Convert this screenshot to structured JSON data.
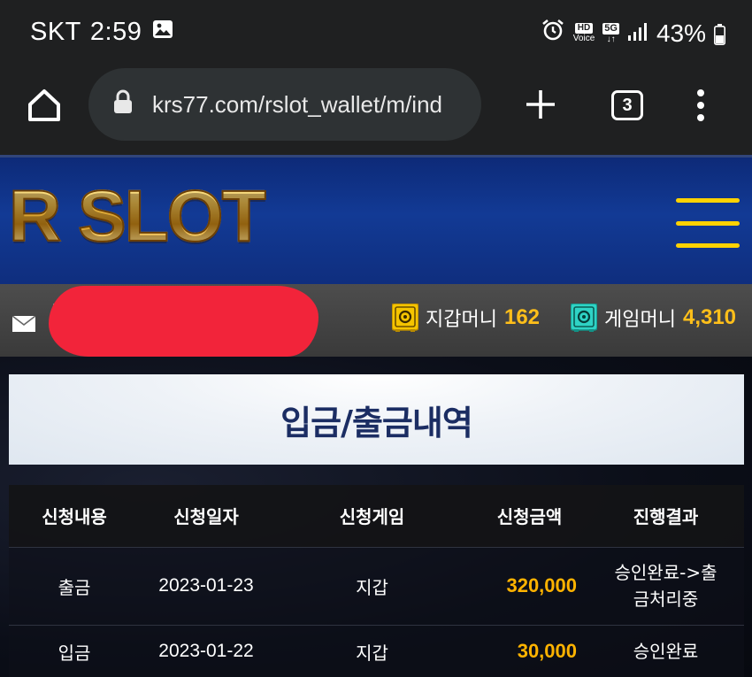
{
  "status_bar": {
    "carrier": "SKT",
    "time": "2:59",
    "hd_label": "HD",
    "voice_label": "Voice",
    "network_label": "5G",
    "battery": "43%"
  },
  "browser": {
    "url": "krs77.com/rslot_wallet/m/ind",
    "tab_count": "3"
  },
  "site": {
    "logo": "R SLOT"
  },
  "wallet": {
    "wallet_money_label": "지갑머니",
    "wallet_money_value": "162",
    "game_money_label": "게임머니",
    "game_money_value": "4,310"
  },
  "page": {
    "title": "입금/출금내역"
  },
  "table": {
    "headers": {
      "type": "신청내용",
      "date": "신청일자",
      "game": "신청게임",
      "amount": "신청금액",
      "result": "진행결과"
    },
    "rows": [
      {
        "type": "출금",
        "date": "2023-01-23",
        "game": "지갑",
        "amount": "320,000",
        "result_line1": "승인완료->출",
        "result_line2": "금처리중"
      },
      {
        "type": "입금",
        "date": "2023-01-22",
        "game": "지갑",
        "amount": "30,000",
        "result_line1": "승인완료",
        "result_line2": ""
      }
    ]
  },
  "colors": {
    "accent_gold": "#ffb300",
    "header_blue": "#123a95",
    "hamburger_yellow": "#ffd200"
  },
  "icons": [
    "image-icon",
    "alarm-icon",
    "signal-icon",
    "battery-icon",
    "home-icon",
    "lock-icon",
    "plus-icon",
    "tabs-icon",
    "more-vert-icon",
    "hamburger-menu-icon",
    "mail-icon",
    "safe-icon"
  ]
}
